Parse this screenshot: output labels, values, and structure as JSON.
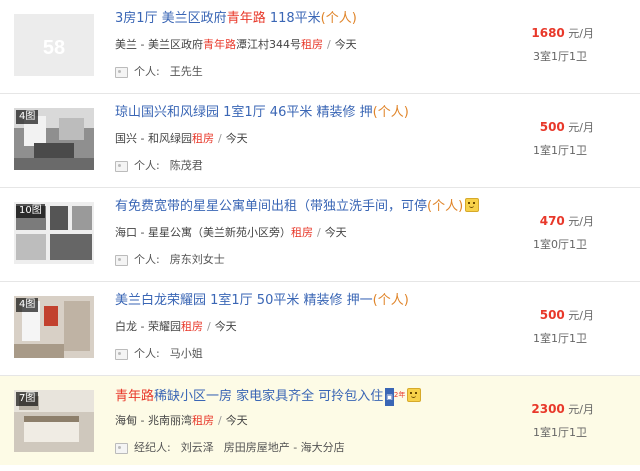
{
  "listings": [
    {
      "badge": "",
      "title": [
        {
          "t": "3房1厅 美兰区政府",
          "c": "blue"
        },
        {
          "t": "青年路",
          "c": "red"
        },
        {
          "t": " 118平米",
          "c": "blue"
        },
        {
          "t": "(个人)",
          "c": "orange"
        }
      ],
      "location": [
        {
          "t": "美兰 - 美兰区政府",
          "c": "dark"
        },
        {
          "t": "青年路",
          "c": "red"
        },
        {
          "t": "潭江村344号",
          "c": "dark"
        },
        {
          "t": "租房",
          "c": "red"
        }
      ],
      "date": "今天",
      "role": "个人:",
      "name": "王先生",
      "agency": "",
      "price": "1680",
      "unit": "元/月",
      "layout": "3室1厅1卫"
    },
    {
      "badge": "4图",
      "title": [
        {
          "t": "琼山国兴和风绿园 1室1厅 46平米 精装修 押",
          "c": "blue"
        },
        {
          "t": "(个人)",
          "c": "orange"
        }
      ],
      "location": [
        {
          "t": "国兴 - 和风绿园",
          "c": "dark"
        },
        {
          "t": "租房",
          "c": "red"
        }
      ],
      "date": "今天",
      "role": "个人:",
      "name": "陈茂君",
      "agency": "",
      "price": "500",
      "unit": "元/月",
      "layout": "1室1厅1卫"
    },
    {
      "badge": "10图",
      "title": [
        {
          "t": "有免费宽带的星星公寓单间出租（带独立洗手间，可停",
          "c": "blue"
        },
        {
          "t": "(个人)",
          "c": "orange"
        }
      ],
      "location": [
        {
          "t": "海口 - 星星公寓（美兰新苑小区旁）",
          "c": "dark"
        },
        {
          "t": "租房",
          "c": "red"
        }
      ],
      "date": "今天",
      "role": "个人:",
      "name": "房东刘女士",
      "agency": "",
      "price": "470",
      "unit": "元/月",
      "layout": "1室0厅1卫"
    },
    {
      "badge": "4图",
      "title": [
        {
          "t": "美兰白龙荣耀园 1室1厅 50平米 精装修 押一",
          "c": "blue"
        },
        {
          "t": "(个人)",
          "c": "orange"
        }
      ],
      "location": [
        {
          "t": "白龙 - 荣耀园",
          "c": "dark"
        },
        {
          "t": "租房",
          "c": "red"
        }
      ],
      "date": "今天",
      "role": "个人:",
      "name": "马小姐",
      "agency": "",
      "price": "500",
      "unit": "元/月",
      "layout": "1室1厅1卫"
    },
    {
      "badge": "7图",
      "title": [
        {
          "t": "青年路",
          "c": "red"
        },
        {
          "t": "稀缺小区一房 家电家具齐全 可拎包入住",
          "c": "blue"
        }
      ],
      "location": [
        {
          "t": "海甸 - 兆南丽湾",
          "c": "dark"
        },
        {
          "t": "租房",
          "c": "red"
        }
      ],
      "date": "今天",
      "role": "经纪人:",
      "name": "刘云泽",
      "agency": "房田房屋地产 - 海大分店",
      "price": "2300",
      "unit": "元/月",
      "layout": "1室1厅1卫"
    }
  ],
  "tag_text": "2年",
  "colors": {
    "link": "#3a66b5",
    "red": "#e8382a",
    "orange": "#e0852a",
    "highlight": "#fdfbe6"
  }
}
